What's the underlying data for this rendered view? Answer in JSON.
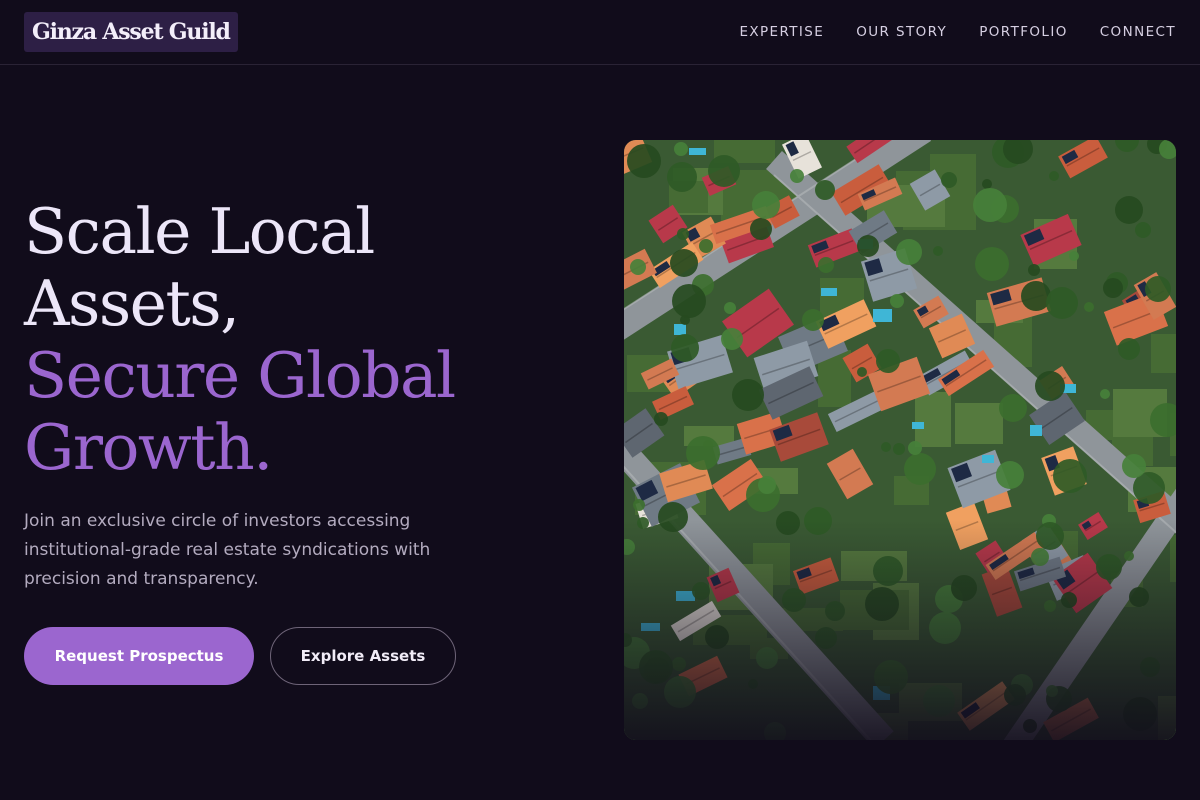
{
  "brand": {
    "name": "Ginza Asset Guild"
  },
  "nav": {
    "items": [
      {
        "label": "EXPERTISE"
      },
      {
        "label": "OUR STORY"
      },
      {
        "label": "PORTFOLIO"
      },
      {
        "label": "CONNECT"
      }
    ]
  },
  "hero": {
    "title_line1": "Scale Local",
    "title_line2": "Assets,",
    "title_line3": "Secure Global",
    "title_line4": "Growth.",
    "subtitle": "Join an exclusive circle of investors accessing institutional-grade real estate syndications with precision and transparency.",
    "primary_cta": "Request Prospectus",
    "secondary_cta": "Explore Assets",
    "image_subject": "aerial-suburban-neighborhood-photo"
  },
  "colors": {
    "background": "#110c1b",
    "accent": "#9b66cf",
    "logo_bg": "#2d1f45",
    "text": "#ece6f8",
    "muted": "#b3abbf"
  }
}
